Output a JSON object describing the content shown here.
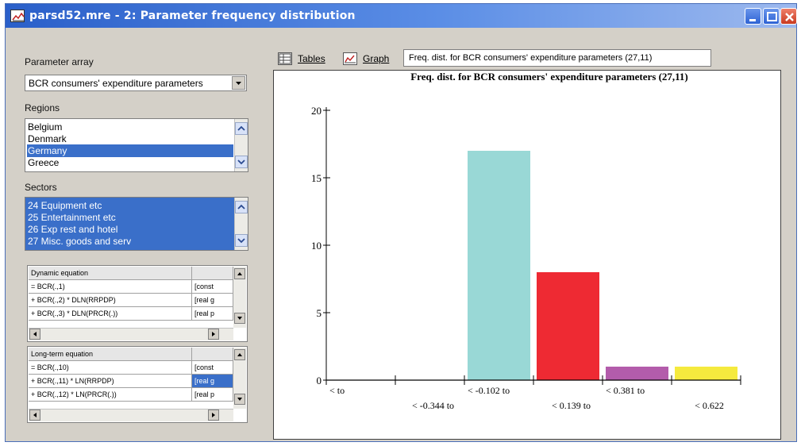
{
  "window": {
    "title": "parsd52.mre - 2: Parameter frequency distribution"
  },
  "left_panel": {
    "parameter_array_label": "Parameter array",
    "parameter_array_value": "BCR  consumers' expenditure parameters",
    "regions_label": "Regions",
    "regions": [
      "Belgium",
      "Denmark",
      "Germany",
      "Greece"
    ],
    "regions_selected": "Germany",
    "sectors_label": "Sectors",
    "sectors": [
      "24 Equipment etc",
      "25 Entertainment etc",
      "26 Exp rest and hotel",
      "27 Misc. goods and serv"
    ]
  },
  "dynamic_grid": {
    "header": "Dynamic equation",
    "rows": [
      {
        "eq": "= BCR(.,1)",
        "type": "[const"
      },
      {
        "eq": "+ BCR(.,2) * DLN(RRPDP)",
        "type": "[real g"
      },
      {
        "eq": "+ BCR(.,3) * DLN(PRCR(.))",
        "type": "[real p"
      }
    ]
  },
  "longterm_grid": {
    "header": "Long-term equation",
    "rows": [
      {
        "eq": "= BCR(.,10)",
        "type": "[const"
      },
      {
        "eq": "+ BCR(.,11) * LN(RRPDP)",
        "type": "[real g"
      },
      {
        "eq": "+ BCR(.,12) * LN(PRCR(.))",
        "type": "[real p"
      }
    ]
  },
  "toolbar": {
    "tables_label": "Tables",
    "graph_label": "Graph",
    "caption": "Freq. dist. for BCR  consumers' expenditure parameters (27,11)"
  },
  "chart_data": {
    "type": "bar",
    "title": "Freq. dist. for BCR  consumers' expenditure parameters (27,11)",
    "categories": [
      "< to -0.344",
      "-0.344 to -0.102",
      "-0.102 to 0.139",
      "0.139 to 0.381",
      "0.381 to 0.622",
      "0.622 to"
    ],
    "values": [
      0,
      0,
      17,
      8,
      1,
      1
    ],
    "colors": [
      "#ffffff",
      "#ffffff",
      "#99d8d6",
      "#ee2a33",
      "#b35cab",
      "#f5ea3e"
    ],
    "tick_labels_upper": [
      "< to",
      "< -0.102 to",
      "< 0.381 to"
    ],
    "tick_labels_lower": [
      "< -0.344 to",
      "< 0.139 to",
      "< 0.622"
    ],
    "yticks": [
      0,
      5,
      10,
      15,
      20
    ],
    "ytick_labels": [
      "0",
      "5",
      "10",
      "15",
      "20"
    ],
    "ylim": [
      0,
      20
    ],
    "grid": false,
    "legend": "none"
  }
}
